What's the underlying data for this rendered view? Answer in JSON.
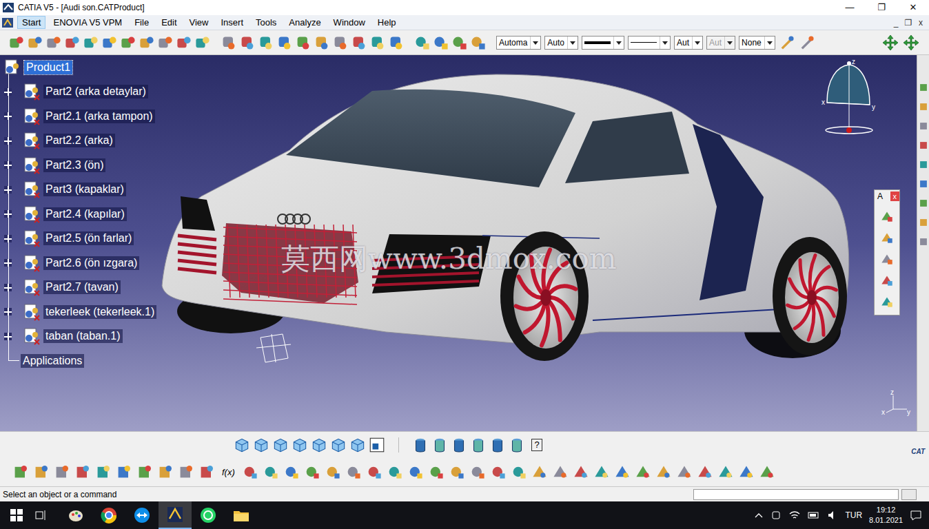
{
  "window": {
    "title": "CATIA V5 - [Audi son.CATProduct]",
    "controls": [
      "—",
      "❐",
      "✕"
    ]
  },
  "menu": {
    "items": [
      {
        "label": "Start",
        "selected": true
      },
      {
        "label": "ENOVIA V5 VPM",
        "selected": false
      },
      {
        "label": "File",
        "selected": false
      },
      {
        "label": "Edit",
        "selected": false
      },
      {
        "label": "View",
        "selected": false
      },
      {
        "label": "Insert",
        "selected": false
      },
      {
        "label": "Tools",
        "selected": false
      },
      {
        "label": "Analyze",
        "selected": false
      },
      {
        "label": "Window",
        "selected": false
      },
      {
        "label": "Help",
        "selected": false
      }
    ],
    "doc_controls": [
      "_",
      "❐",
      "x"
    ]
  },
  "toolbar": {
    "fields": [
      {
        "kind": "text",
        "value": "Automa",
        "disabled": false
      },
      {
        "kind": "text",
        "value": "Auto",
        "disabled": false
      },
      {
        "kind": "line",
        "thick": true,
        "disabled": false
      },
      {
        "kind": "line",
        "thick": false,
        "disabled": false
      },
      {
        "kind": "text",
        "value": "Aut",
        "disabled": false
      },
      {
        "kind": "text",
        "value": "Aut",
        "disabled": true
      },
      {
        "kind": "text",
        "value": "None",
        "disabled": false
      }
    ]
  },
  "tree": {
    "root": {
      "label": "Product1",
      "selected": true
    },
    "children": [
      {
        "label": "Part2 (arka detaylar)",
        "expanded": false
      },
      {
        "label": "Part2.1 (arka tampon)",
        "expanded": false
      },
      {
        "label": "Part2.2 (arka)",
        "expanded": false
      },
      {
        "label": "Part2.3 (ön)",
        "expanded": false
      },
      {
        "label": "Part3 (kapaklar)",
        "expanded": false
      },
      {
        "label": "Part2.4 (kapılar)",
        "expanded": false
      },
      {
        "label": "Part2.5 (ön farlar)",
        "expanded": false
      },
      {
        "label": "Part2.6 (ön ızgara)",
        "expanded": false
      },
      {
        "label": "Part2.7 (tavan)",
        "expanded": false
      },
      {
        "label": "tekerleek (tekerleek.1)",
        "expanded": false
      },
      {
        "label": "taban (taban.1)",
        "expanded": false
      }
    ],
    "applications": "Applications"
  },
  "viewport": {
    "watermark": "莫西网www.3dmox.com",
    "compass_labels": [
      "z",
      "x",
      "y"
    ],
    "axis_labels": [
      "z",
      "x",
      "y"
    ],
    "palette": {
      "title": "A",
      "close": "x"
    }
  },
  "bottom_toolbar": {
    "formula_icon": "f(x)",
    "help_icon": "?",
    "logo": "CAT"
  },
  "status_bar": {
    "prompt": "Select an object or a command",
    "input": ""
  },
  "taskbar": {
    "language": "TUR",
    "time": "19:12",
    "date": "8.01.2021",
    "apps": [
      {
        "kind": "paint",
        "selected": false
      },
      {
        "kind": "chrome",
        "selected": false
      },
      {
        "kind": "teamviewer",
        "selected": false
      },
      {
        "kind": "catia",
        "selected": true
      },
      {
        "kind": "whatsapp",
        "selected": false
      },
      {
        "kind": "folder",
        "selected": false
      }
    ]
  }
}
